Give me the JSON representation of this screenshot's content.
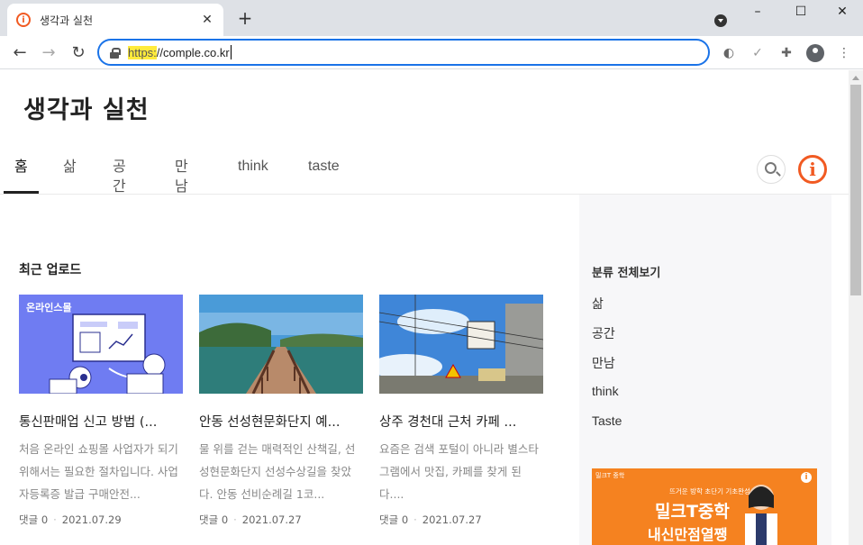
{
  "browser": {
    "tab_title": "생각과 실천",
    "tab_favicon": "i",
    "new_tab": "+",
    "url_scheme": "https:",
    "url_rest": "//comple.co.kr",
    "window_controls": [
      "–",
      "☐",
      "✕"
    ]
  },
  "site": {
    "title": "생각과 실천",
    "logo_letter": "i",
    "accent_color": "#f15a22"
  },
  "nav": {
    "items": [
      "홈",
      "삶",
      "공간",
      "만남",
      "think",
      "taste"
    ],
    "active": "홈"
  },
  "recent": {
    "heading": "최근 업로드",
    "posts": [
      {
        "title": "통신판매업 신고 방법 (...",
        "summary": "처음 온라인 쇼핑몰 사업자가 되기 위해서는 필요한 절차입니다. 사업자등록증 발급 구매안전...",
        "comments": "댓글 0",
        "date": "2021.07.29",
        "thumb_label": "온라인스몰"
      },
      {
        "title": "안동 선성현문화단지 예...",
        "summary": "물 위를 걷는 매력적인 산책길, 선성현문화단지 선성수상길을 찾았다. 안동 선비순례길 1코...",
        "comments": "댓글 0",
        "date": "2021.07.27"
      },
      {
        "title": "상주 경천대 근처 카페 ...",
        "summary": "요즘은 검색 포털이 아니라 별스타그램에서 맛집, 카페를 찾게 된다....",
        "comments": "댓글 0",
        "date": "2021.07.27"
      }
    ]
  },
  "sidebar": {
    "category_title": "분류 전체보기",
    "categories": [
      "삶",
      "공간",
      "만남",
      "think",
      "Taste"
    ],
    "banner": {
      "brand": "밀크T 중학",
      "sub": "뜨거운 방학 초단기 기초완성",
      "main1": "밀크T중학",
      "main2": "내신만점열쨍",
      "info": "i"
    }
  }
}
